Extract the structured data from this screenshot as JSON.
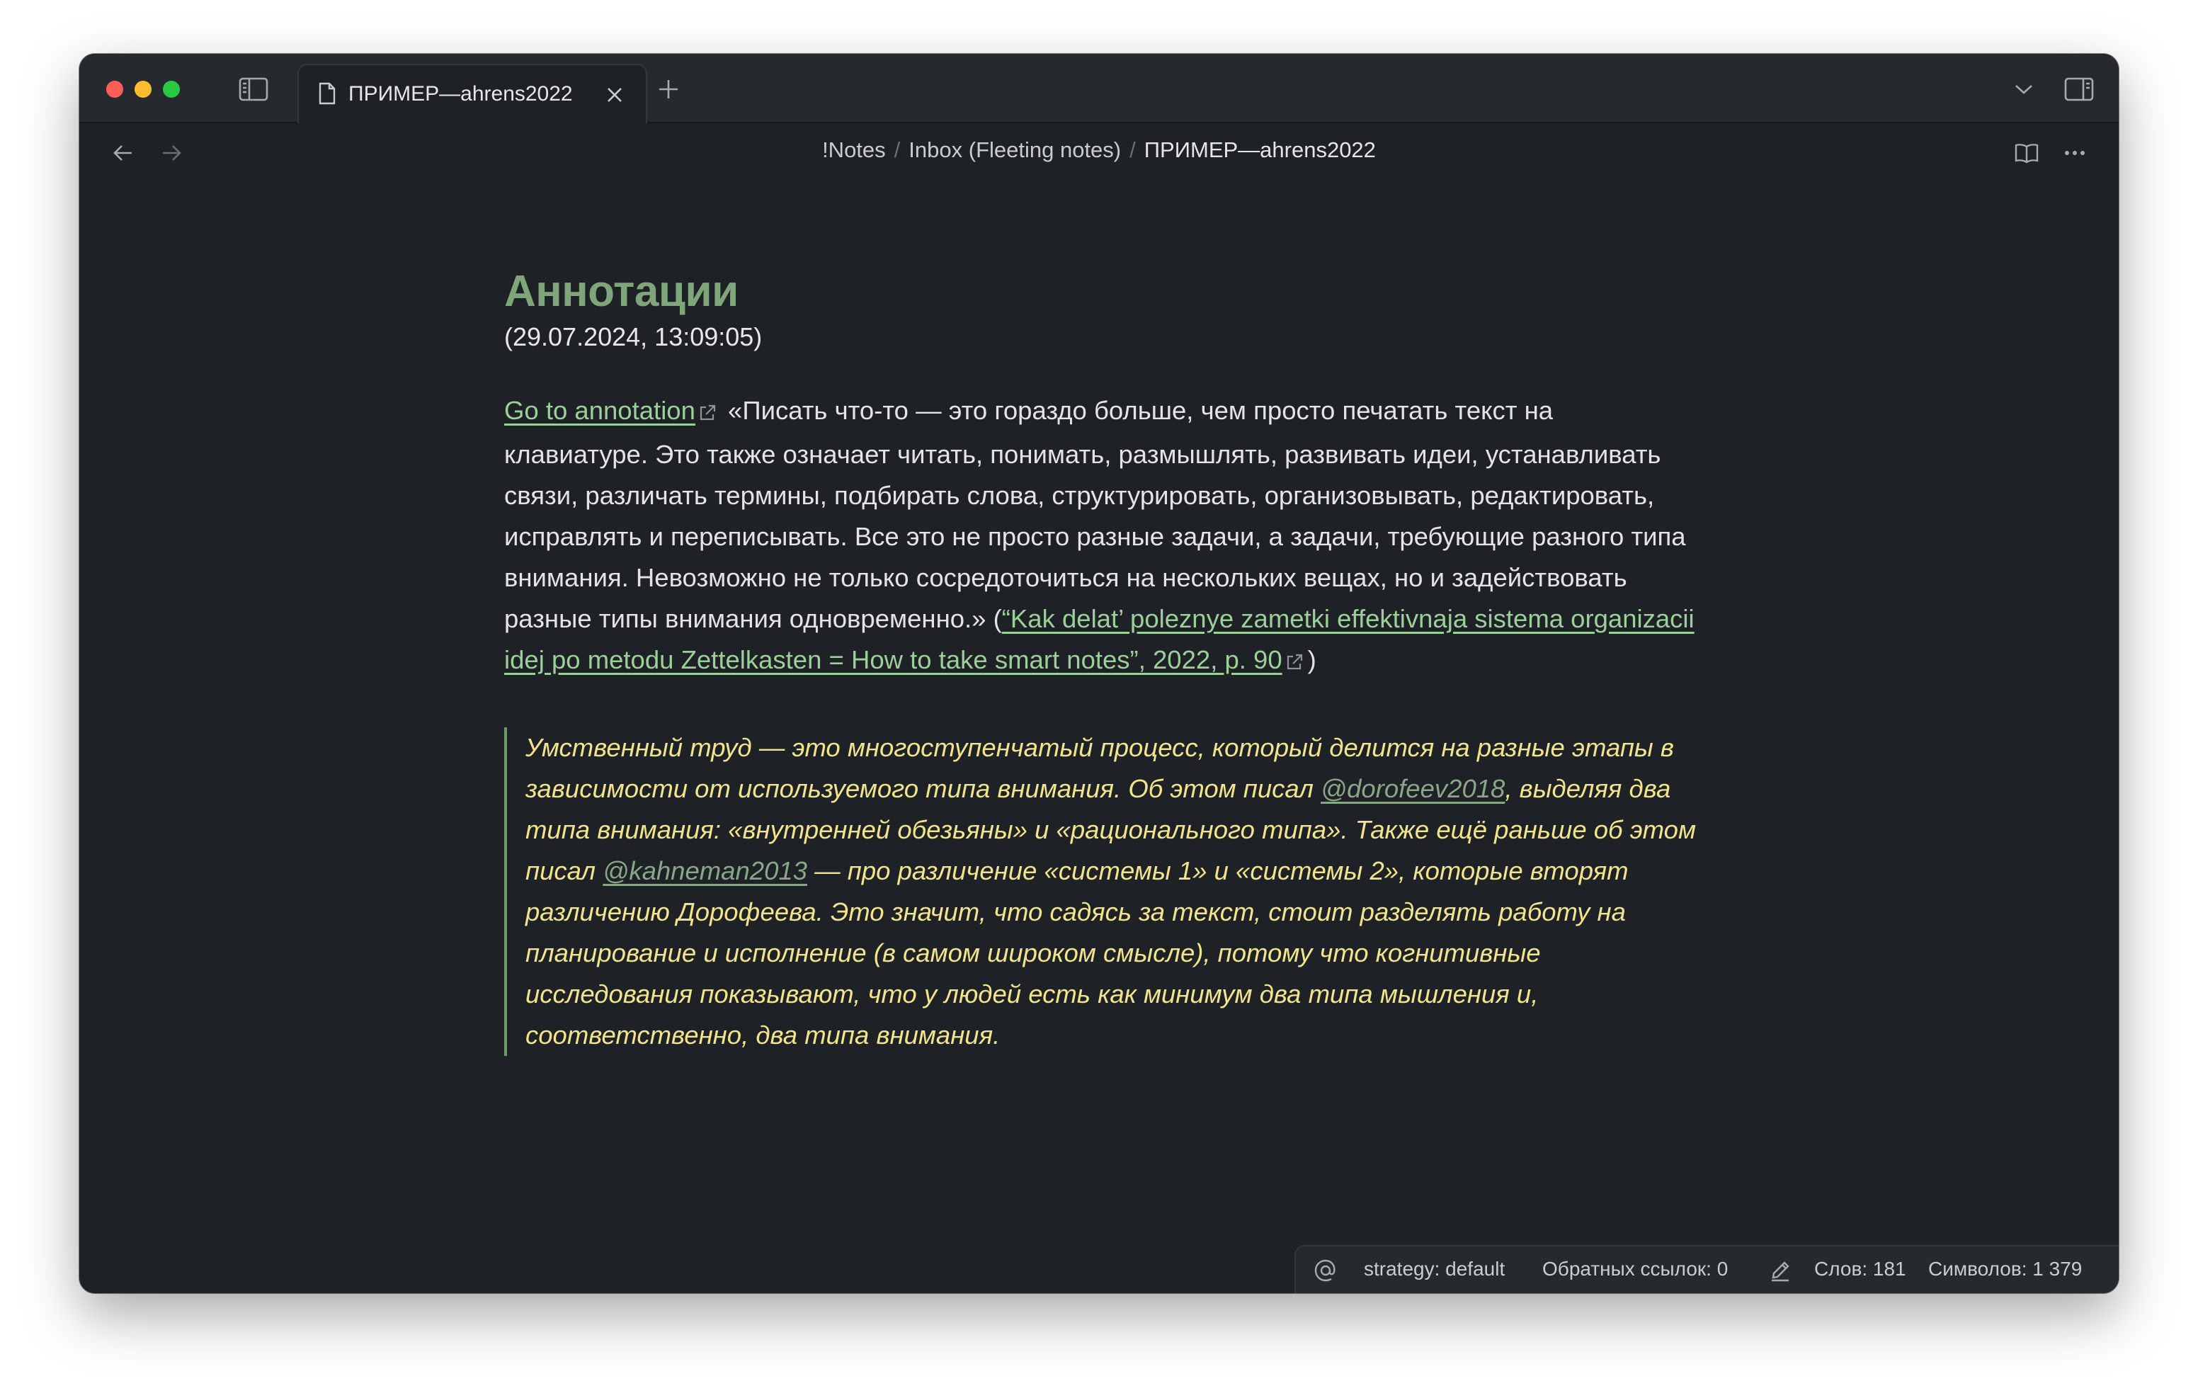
{
  "window": {
    "tab_title": "ПРИМЕР—ahrens2022",
    "icons": [
      "sidebar-toggle-icon",
      "file-icon",
      "close-icon",
      "plus-icon",
      "chevron-down-icon",
      "right-sidebar-icon",
      "arrow-left-icon",
      "arrow-right-icon",
      "book-icon",
      "more-icon"
    ]
  },
  "breadcrumb": {
    "items": [
      "!Notes",
      "Inbox (Fleeting notes)",
      "ПРИМЕР—ahrens2022"
    ],
    "separator": "/"
  },
  "note": {
    "heading": "Аннотации",
    "date": "(29.07.2024, 13:09:05)",
    "annotation_link": "Go to annotation",
    "quote_text": " «Писать что-то — это гораздо больше, чем просто печатать текст на клавиатуре. Это также означает читать, понимать, размышлять, развивать идеи, устанавливать связи, различать термины, подбирать слова, структурировать, организовывать, редактировать, исправлять и  переписывать. Все это не просто разные задачи, а задачи, требующие разного типа внимания. Невозможно не только сосредоточиться на  нескольких вещах, но  и  задействовать разные типы внимания одновременно.» (",
    "citation_link": "“Kak delat’ poleznye zametki effektivnaja sistema organizacii idej po metodu Zettelkasten = How to take smart notes”, 2022, p. 90",
    "citation_close": ")",
    "blockquote": {
      "part1": "Умственный труд — это многоступенчатый процесс, который делится на разные этапы в зависимости от используемого типа внимания. Об этом писал ",
      "mention1": "@dorofeev2018",
      "part2": ", выделяя два типа внимания:  «внутренней обезьяны» и «рационального типа». Также ещё раньше об этом писал ",
      "mention2": "@kahneman2013",
      "part3": " — про различение «системы 1» и «системы 2», которые вторят различению Дорофеева. Это значит, что садясь за текст, стоит разделять работу на планирование и исполнение (в самом широком смысле), потому что когнитивные исследования показывают, что у людей есть как минимум два типа мышления и, соответственно, два типа внимания."
    }
  },
  "statusbar": {
    "strategy": "strategy: default",
    "backlinks": "Обратных ссылок: 0",
    "words": "Слов: 181",
    "chars": "Символов: 1 379"
  },
  "colors": {
    "background": "#1e2125",
    "heading": "#7fa57a",
    "link": "#9ccf9a",
    "quote_text": "#f2e48a",
    "quote_border": "#6c9b68"
  }
}
